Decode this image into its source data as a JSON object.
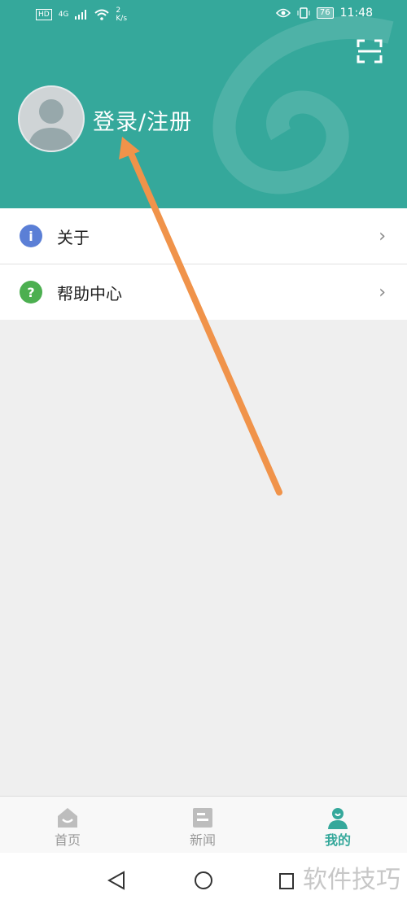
{
  "status_bar": {
    "hd": "HD",
    "network": "4G",
    "speed": "2 K/s",
    "battery": "76",
    "time": "11:48"
  },
  "header": {
    "login_text": "登录/注册",
    "icons": [
      "scan-icon",
      "avatar"
    ]
  },
  "menu": {
    "items": [
      {
        "label": "关于",
        "icon": "info-icon",
        "icon_glyph": "i",
        "color": "#5b7fd6"
      },
      {
        "label": "帮助中心",
        "icon": "help-icon",
        "icon_glyph": "?",
        "color": "#4caf50"
      }
    ]
  },
  "bottom_nav": {
    "tabs": [
      {
        "label": "首页",
        "icon": "home-icon",
        "active": false
      },
      {
        "label": "新闻",
        "icon": "news-icon",
        "active": false
      },
      {
        "label": "我的",
        "icon": "profile-icon",
        "active": true
      }
    ]
  },
  "colors": {
    "accent": "#35a89b",
    "inactive": "#9a9a9a"
  },
  "watermark": "软件技巧"
}
